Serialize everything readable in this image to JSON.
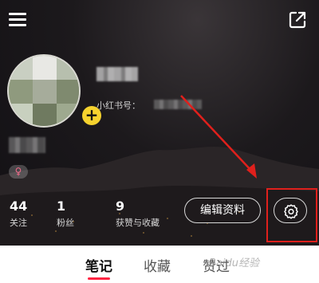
{
  "profile": {
    "redid_label": "小红书号：",
    "gender_symbol": "♀"
  },
  "stats": [
    {
      "value": "44",
      "label": "关注"
    },
    {
      "value": "1",
      "label": "粉丝"
    },
    {
      "value": "9",
      "label": "获赞与收藏"
    }
  ],
  "actions": {
    "edit_label": "编辑资料",
    "avatar_add": "+"
  },
  "tabs": [
    {
      "label": "笔记",
      "active": true
    },
    {
      "label": "收藏",
      "active": false
    },
    {
      "label": "赞过",
      "active": false
    }
  ],
  "watermark": "Baidu经验",
  "icons": {
    "menu": "menu-icon",
    "share": "share-icon",
    "settings": "gear-icon",
    "gender": "female-icon",
    "add": "plus-icon"
  },
  "colors": {
    "accent": "#ff2442",
    "annotation": "#e0201c",
    "avatar_add": "#f6d22e"
  }
}
